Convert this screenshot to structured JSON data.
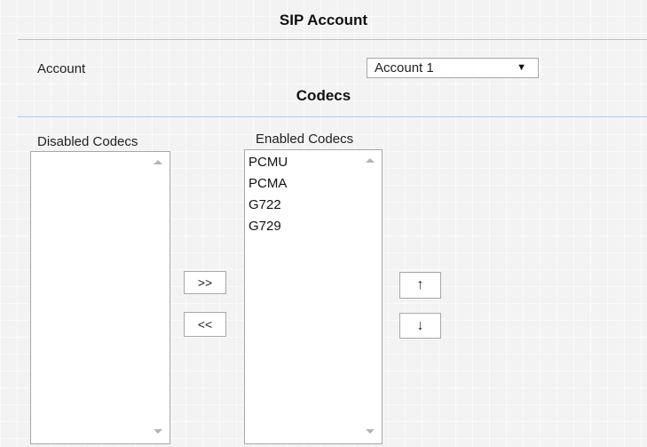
{
  "sip_account": {
    "title": "SIP Account",
    "account_label": "Account",
    "account_select": {
      "selected": "Account 1",
      "caret_icon": "dropdown-triangle-icon"
    }
  },
  "codecs": {
    "title": "Codecs",
    "disabled_list": {
      "label": "Disabled Codecs",
      "items": []
    },
    "enabled_list": {
      "label": "Enabled Codecs",
      "items": [
        "PCMU",
        "PCMA",
        "G722",
        "G729"
      ]
    },
    "buttons": {
      "move_right": ">>",
      "move_left": "<<",
      "move_up": "↑",
      "move_down": "↓"
    }
  },
  "colors": {
    "divider": "#a9c7e6",
    "border": "#a8a8a8",
    "scroll_arrow": "#b4b4b4"
  }
}
